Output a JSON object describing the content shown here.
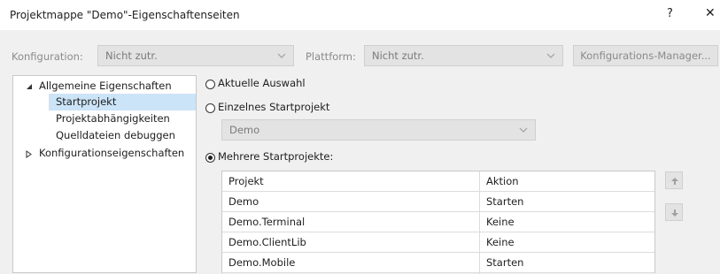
{
  "dialog": {
    "title": "Projektmappe \"Demo\"-Eigenschaftenseiten",
    "help_label": "?",
    "close_label": "✕"
  },
  "toolbar": {
    "config_label": "Konfiguration:",
    "config_value": "Nicht zutr.",
    "platform_label": "Plattform:",
    "platform_value": "Nicht zutr.",
    "manager_button": "Konfigurations-Manager..."
  },
  "tree": {
    "root": "Allgemeine Eigenschaften",
    "children": [
      "Startprojekt",
      "Projektabhängigkeiten",
      "Quelldateien debuggen"
    ],
    "collapsed": "Konfigurationseigenschaften",
    "selected": "Startprojekt"
  },
  "options": {
    "current_selection": "Aktuelle Auswahl",
    "single_project": "Einzelnes Startprojekt",
    "single_project_value": "Demo",
    "multiple_projects": "Mehrere Startprojekte:",
    "checked": "multiple_projects"
  },
  "grid": {
    "headers": [
      "Projekt",
      "Aktion"
    ],
    "rows": [
      [
        "Demo",
        "Starten"
      ],
      [
        "Demo.Terminal",
        "Keine"
      ],
      [
        "Demo.ClientLib",
        "Keine"
      ],
      [
        "Demo.Mobile",
        "Starten"
      ]
    ]
  },
  "colors": {
    "selection": "#cce4f7",
    "background": "#f0f0f0",
    "disabled_text": "#8a8a8a"
  }
}
